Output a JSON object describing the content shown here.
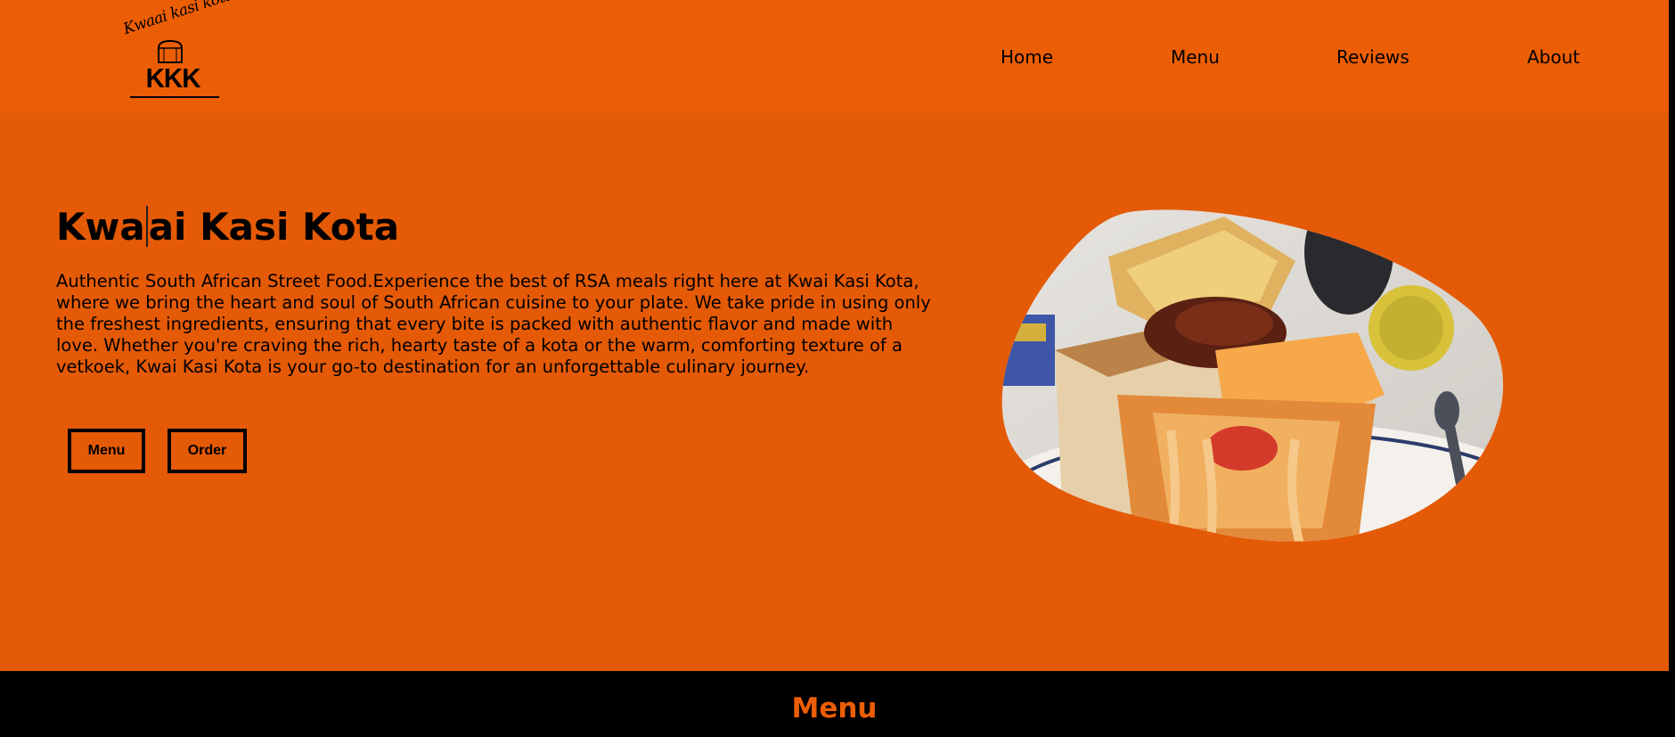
{
  "brand": {
    "logo_script": "Kwaai kasi kota",
    "logo_text": "KKK"
  },
  "nav": {
    "items": [
      {
        "label": "Home"
      },
      {
        "label": "Menu"
      },
      {
        "label": "Reviews"
      },
      {
        "label": "About"
      }
    ]
  },
  "hero": {
    "title_before_caret": "Kwa",
    "title_after_caret": "ai Kasi Kota",
    "description": "Authentic South African Street Food.Experience the best of RSA meals right here at Kwai Kasi Kota, where we bring the heart and soul of South African cuisine to your plate. We take pride in using only the freshest ingredients, ensuring that every bite is packed with authentic flavor and made with love. Whether you're craving the rich, hearty taste of a kota or the warm, comforting texture of a vetkoek, Kwai Kasi Kota is your go-to destination for an unforgettable culinary journey.",
    "buttons": {
      "menu": "Menu",
      "order": "Order"
    }
  },
  "menu_section": {
    "heading": "Menu"
  },
  "colors": {
    "header_orange": "#ec5e05",
    "hero_orange": "#e45a06",
    "text_dark": "#000000",
    "accent": "#ec5e05"
  }
}
